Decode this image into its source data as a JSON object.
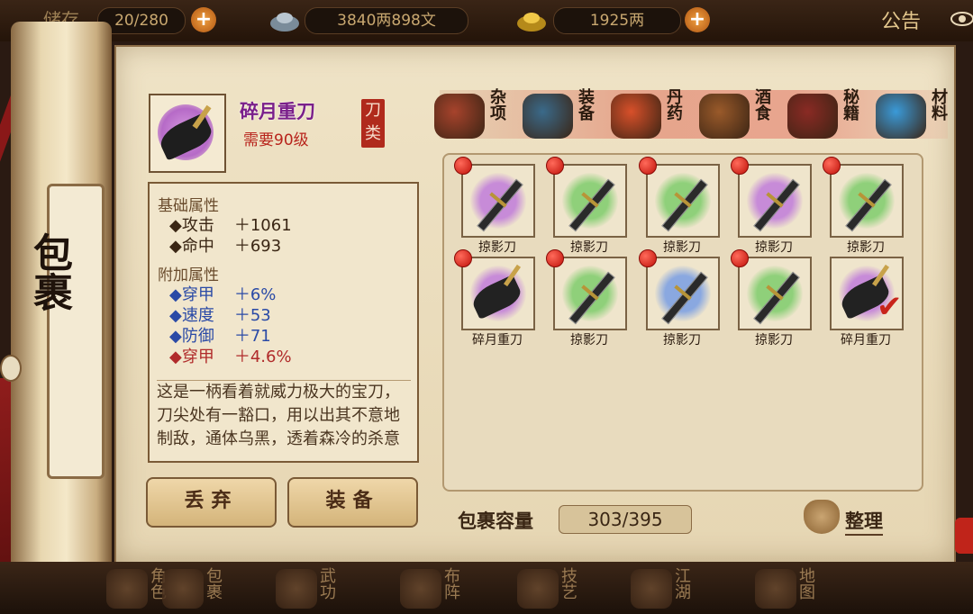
{
  "topbar": {
    "bag_label": "储存",
    "bag_count": "20/280",
    "money": "3840两898文",
    "gold": "1925两",
    "notice_label": "公告"
  },
  "item": {
    "name": "碎月重刀",
    "requirement": "需要90级",
    "category_seal": "刀类",
    "base_title": "基础属性",
    "base_stats": [
      {
        "k": "攻击",
        "v": "＋1061"
      },
      {
        "k": "命中",
        "v": "＋693"
      }
    ],
    "extra_title": "附加属性",
    "extra_stats": [
      {
        "k": "穿甲",
        "v": "＋6%",
        "color": "#2a4aa6"
      },
      {
        "k": "速度",
        "v": "＋53",
        "color": "#2a4aa6"
      },
      {
        "k": "防御",
        "v": "＋71",
        "color": "#2a4aa6"
      },
      {
        "k": "穿甲",
        "v": "＋4.6%",
        "color": "#b02a2a"
      }
    ],
    "description": "这是一柄看着就威力极大的宝刀，刀尖处有一豁口，用以出其不意地制敌，通体乌黑，透着森冷的杀意"
  },
  "buttons": {
    "discard": "丢弃",
    "equip": "装备"
  },
  "side_title": "包裹",
  "tabs": [
    {
      "label": "杂项",
      "icon": "jar-icon",
      "color": "#a7432c"
    },
    {
      "label": "装备",
      "icon": "weapon-bundle-icon",
      "color": "#3a6a8a"
    },
    {
      "label": "丹药",
      "icon": "pill-icon",
      "color": "#d8502a"
    },
    {
      "label": "酒食",
      "icon": "wine-food-icon",
      "color": "#9a5a2a"
    },
    {
      "label": "秘籍",
      "icon": "book-icon",
      "color": "#8a2a24"
    },
    {
      "label": "材料",
      "icon": "crystal-icon",
      "color": "#3a9ad8"
    }
  ],
  "slots": [
    {
      "name": "掠影刀",
      "glow": "#c78bd8",
      "dot": true,
      "type": "thin"
    },
    {
      "name": "掠影刀",
      "glow": "#8fd07a",
      "dot": true,
      "type": "thin"
    },
    {
      "name": "掠影刀",
      "glow": "#8fd07a",
      "dot": true,
      "type": "thin"
    },
    {
      "name": "掠影刀",
      "glow": "#c78bd8",
      "dot": true,
      "type": "thin"
    },
    {
      "name": "掠影刀",
      "glow": "#8fd07a",
      "dot": true,
      "type": "thin"
    },
    {
      "name": "碎月重刀",
      "glow": "#c78bd8",
      "dot": true,
      "type": "heavy"
    },
    {
      "name": "掠影刀",
      "glow": "#8fd07a",
      "dot": true,
      "type": "thin"
    },
    {
      "name": "掠影刀",
      "glow": "#8aa8e0",
      "dot": true,
      "type": "thin"
    },
    {
      "name": "掠影刀",
      "glow": "#8fd07a",
      "dot": true,
      "type": "thin"
    },
    {
      "name": "碎月重刀",
      "glow": "#c78bd8",
      "dot": false,
      "type": "heavy",
      "selected": true
    }
  ],
  "capacity": {
    "label": "包裹容量",
    "value": "303/395"
  },
  "sort_label": "整理",
  "bottom_nav": [
    {
      "label": "角色"
    },
    {
      "label": "包裹"
    },
    {
      "label": "武功"
    },
    {
      "label": "布阵"
    },
    {
      "label": "技艺"
    },
    {
      "label": "江湖"
    },
    {
      "label": "地图"
    }
  ]
}
